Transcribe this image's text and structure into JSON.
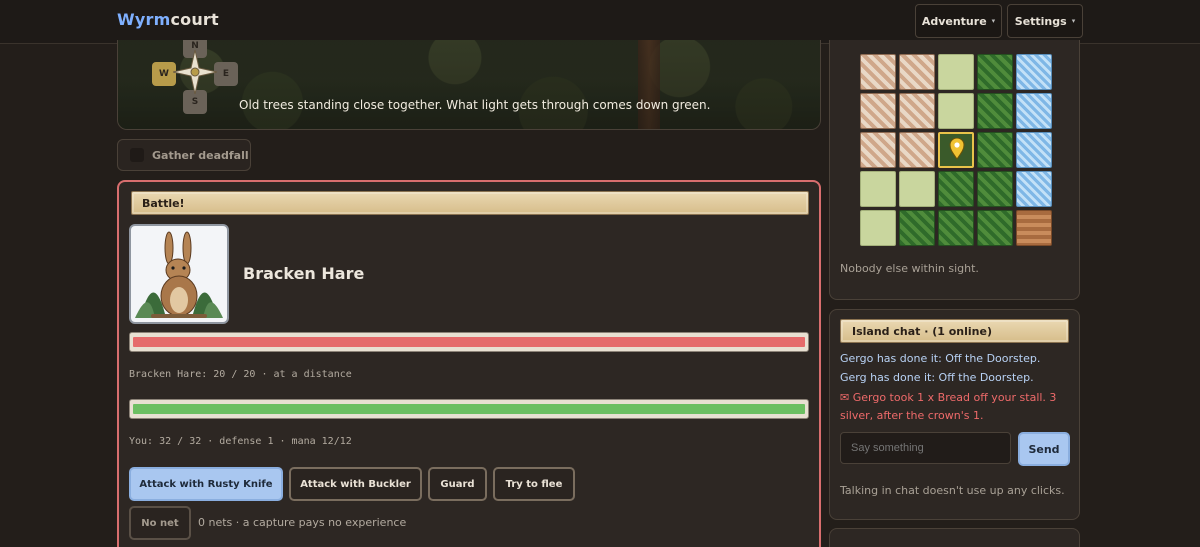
{
  "brand": {
    "part1": "Wyrm",
    "part2": "court"
  },
  "nav": {
    "adventure": "Adventure",
    "settings": "Settings",
    "caret": "▾"
  },
  "compass": {
    "n": "N",
    "s": "S",
    "e": "E",
    "w": "W"
  },
  "scene": {
    "description": "Old trees standing close together. What light gets through comes down green."
  },
  "actions": {
    "gather": "Gather deadfall"
  },
  "battle": {
    "banner": "Battle!",
    "enemy_name": "Bracken Hare",
    "enemy_status": "Bracken Hare: 20 / 20 · at a distance",
    "enemy_hp_fraction": 1.0,
    "player_status": "You: 32 / 32 · defense 1 · mana 12/12",
    "player_hp_fraction": 1.0,
    "buttons": {
      "attack_knife": "Attack with Rusty Knife",
      "attack_buckler": "Attack with Buckler",
      "guard": "Guard",
      "flee": "Try to flee",
      "no_net": "No net"
    },
    "nets_info": "0 nets · a capture pays no experience",
    "colors": {
      "enemy_hp": "#e56b6b",
      "player_hp": "#6cbf62",
      "border": "#d86e6e"
    }
  },
  "map": {
    "grid": [
      [
        "town",
        "town",
        "field",
        "forest",
        "water"
      ],
      [
        "town",
        "town",
        "field",
        "forest",
        "water"
      ],
      [
        "town",
        "town",
        "player",
        "forest",
        "water"
      ],
      [
        "field",
        "field",
        "forest",
        "forest",
        "water"
      ],
      [
        "field",
        "forest",
        "forest",
        "forest",
        "bridge"
      ]
    ],
    "nearby": "Nobody else within sight."
  },
  "chat": {
    "header": "Island chat · (1 online)",
    "messages": [
      "Gergo has done it: Off the Doorstep.",
      "Gerg has done it: Off the Doorstep."
    ],
    "alert": "✉ Gergo took 1 x Bread off your stall. 3 silver, after the crown's 1.",
    "placeholder": "Say something",
    "send": "Send",
    "note": "Talking in chat doesn't use up any clicks."
  }
}
